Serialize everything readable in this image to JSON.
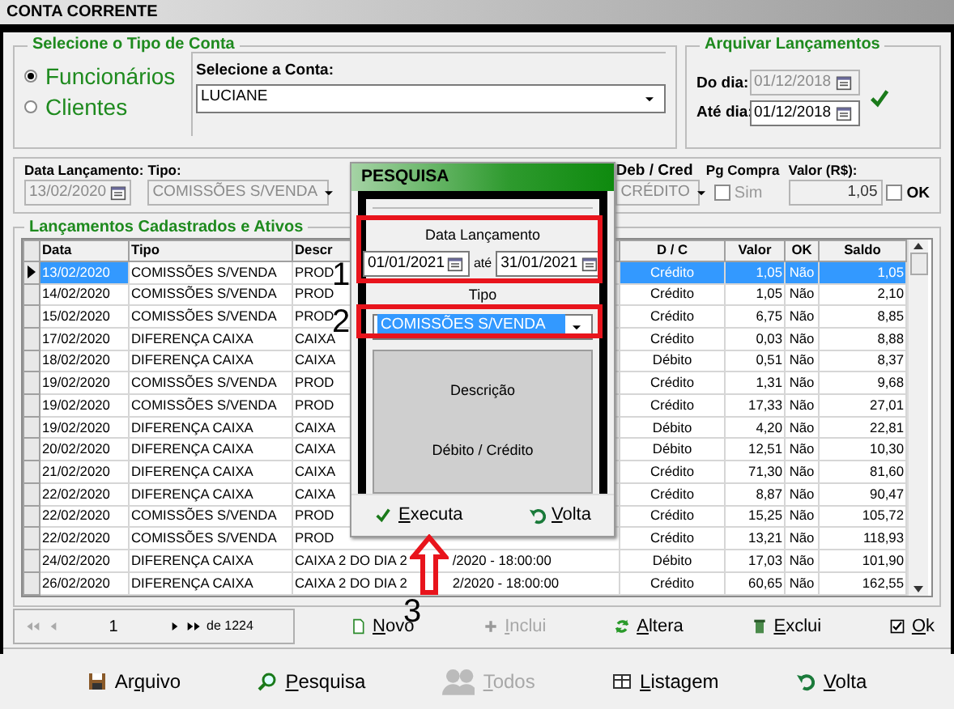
{
  "window": {
    "title": "CONTA CORRENTE"
  },
  "account_type": {
    "title": "Selecione o Tipo de Conta",
    "options": [
      {
        "label": "Funcionários",
        "selected": true
      },
      {
        "label": "Clientes",
        "selected": false
      }
    ],
    "account_label": "Selecione a Conta:",
    "account": "LUCIANE"
  },
  "archive": {
    "title": "Arquivar Lançamentos",
    "from_label": "Do dia:",
    "from": "01/12/2018",
    "from_disabled": true,
    "to_label": "Até dia:",
    "to": "01/12/2018"
  },
  "entry": {
    "date_label": "Data Lançamento:",
    "date": "13/02/2020",
    "type_label": "Tipo:",
    "type": "COMISSÕES S/VENDA",
    "debcred_label": "Deb / Cred",
    "debcred": "CRÉDITO",
    "pg_label": "Pg Compra",
    "pg_option": "Sim",
    "pg_checked": false,
    "value_label": "Valor (R$):",
    "value": "1,05",
    "ok_label": "OK",
    "ok_checked": false
  },
  "entries": {
    "title": "Lançamentos Cadastrados e Ativos",
    "columns": [
      "Data",
      "Tipo",
      "Descr",
      "D / C",
      "Valor",
      "OK",
      "Saldo"
    ],
    "rows": [
      {
        "date": "13/02/2020",
        "type": "COMISSÕES S/VENDA",
        "description": "PROD",
        "dc": "Crédito",
        "value": "1,05",
        "ok": "Não",
        "balance": "1,05",
        "selected": true
      },
      {
        "date": "14/02/2020",
        "type": "COMISSÕES S/VENDA",
        "description": "PROD",
        "dc": "Crédito",
        "value": "1,05",
        "ok": "Não",
        "balance": "2,10",
        "selected": false
      },
      {
        "date": "15/02/2020",
        "type": "COMISSÕES S/VENDA",
        "description": "PROD",
        "dc": "Crédito",
        "value": "6,75",
        "ok": "Não",
        "balance": "8,85",
        "selected": false
      },
      {
        "date": "17/02/2020",
        "type": "DIFERENÇA CAIXA",
        "description": "CAIXA",
        "dc": "Crédito",
        "value": "0,03",
        "ok": "Não",
        "balance": "8,88",
        "selected": false
      },
      {
        "date": "18/02/2020",
        "type": "DIFERENÇA CAIXA",
        "description": "CAIXA",
        "dc": "Débito",
        "value": "0,51",
        "ok": "Não",
        "balance": "8,37",
        "selected": false
      },
      {
        "date": "19/02/2020",
        "type": "COMISSÕES S/VENDA",
        "description": "PROD",
        "dc": "Crédito",
        "value": "1,31",
        "ok": "Não",
        "balance": "9,68",
        "selected": false
      },
      {
        "date": "19/02/2020",
        "type": "COMISSÕES S/VENDA",
        "description": "PROD",
        "dc": "Crédito",
        "value": "17,33",
        "ok": "Não",
        "balance": "27,01",
        "selected": false
      },
      {
        "date": "19/02/2020",
        "type": "DIFERENÇA CAIXA",
        "description": "CAIXA",
        "dc": "Débito",
        "value": "4,20",
        "ok": "Não",
        "balance": "22,81",
        "selected": false
      },
      {
        "date": "20/02/2020",
        "type": "DIFERENÇA CAIXA",
        "description": "CAIXA",
        "dc": "Débito",
        "value": "12,51",
        "ok": "Não",
        "balance": "10,30",
        "selected": false
      },
      {
        "date": "21/02/2020",
        "type": "DIFERENÇA CAIXA",
        "description": "CAIXA",
        "dc": "Crédito",
        "value": "71,30",
        "ok": "Não",
        "balance": "81,60",
        "selected": false
      },
      {
        "date": "22/02/2020",
        "type": "DIFERENÇA CAIXA",
        "description": "CAIXA",
        "dc": "Crédito",
        "value": "8,87",
        "ok": "Não",
        "balance": "90,47",
        "selected": false
      },
      {
        "date": "22/02/2020",
        "type": "COMISSÕES S/VENDA",
        "description": "PROD",
        "dc": "Crédito",
        "value": "15,25",
        "ok": "Não",
        "balance": "105,72",
        "selected": false
      },
      {
        "date": "22/02/2020",
        "type": "COMISSÕES S/VENDA",
        "description": "PROD",
        "dc": "Crédito",
        "value": "13,21",
        "ok": "Não",
        "balance": "118,93",
        "selected": false
      },
      {
        "date": "24/02/2020",
        "type": "DIFERENÇA CAIXA",
        "description": "CAIXA 2 DO DIA 2",
        "description_end": "/2020 - 18:00:00",
        "dc": "Débito",
        "value": "17,03",
        "ok": "Não",
        "balance": "101,90",
        "selected": false
      },
      {
        "date": "26/02/2020",
        "type": "DIFERENÇA CAIXA",
        "description": "CAIXA 2 DO DIA 2",
        "description_end": "2/2020 - 18:00:00",
        "dc": "Crédito",
        "value": "60,65",
        "ok": "Não",
        "balance": "162,55",
        "selected": false
      }
    ]
  },
  "pager": {
    "page": "1",
    "total": "de 1224"
  },
  "actions": [
    {
      "label": "Novo",
      "disabled": false
    },
    {
      "label": "Inclui",
      "disabled": true
    },
    {
      "label": "Altera",
      "disabled": false
    },
    {
      "label": "Exclui",
      "disabled": false
    },
    {
      "label": "Ok",
      "disabled": false
    }
  ],
  "toolbar": [
    {
      "label": "Arquivo",
      "disabled": false
    },
    {
      "label": "Pesquisa",
      "disabled": false
    },
    {
      "label": "Todos",
      "disabled": true
    },
    {
      "label": "Listagem",
      "disabled": false
    },
    {
      "label": "Volta",
      "disabled": false
    }
  ],
  "search_dialog": {
    "title": "PESQUISA",
    "date_label": "Data Lançamento",
    "from": "01/01/2021",
    "until_label": "até",
    "to": "31/01/2021",
    "type_label": "Tipo",
    "type": "COMISSÕES S/VENDA",
    "description_label": "Descrição",
    "debcred_label": "Débito / Crédito",
    "buttons": [
      {
        "label": "Executa"
      },
      {
        "label": "Volta"
      }
    ]
  },
  "annotations": [
    "1",
    "2",
    "3"
  ]
}
